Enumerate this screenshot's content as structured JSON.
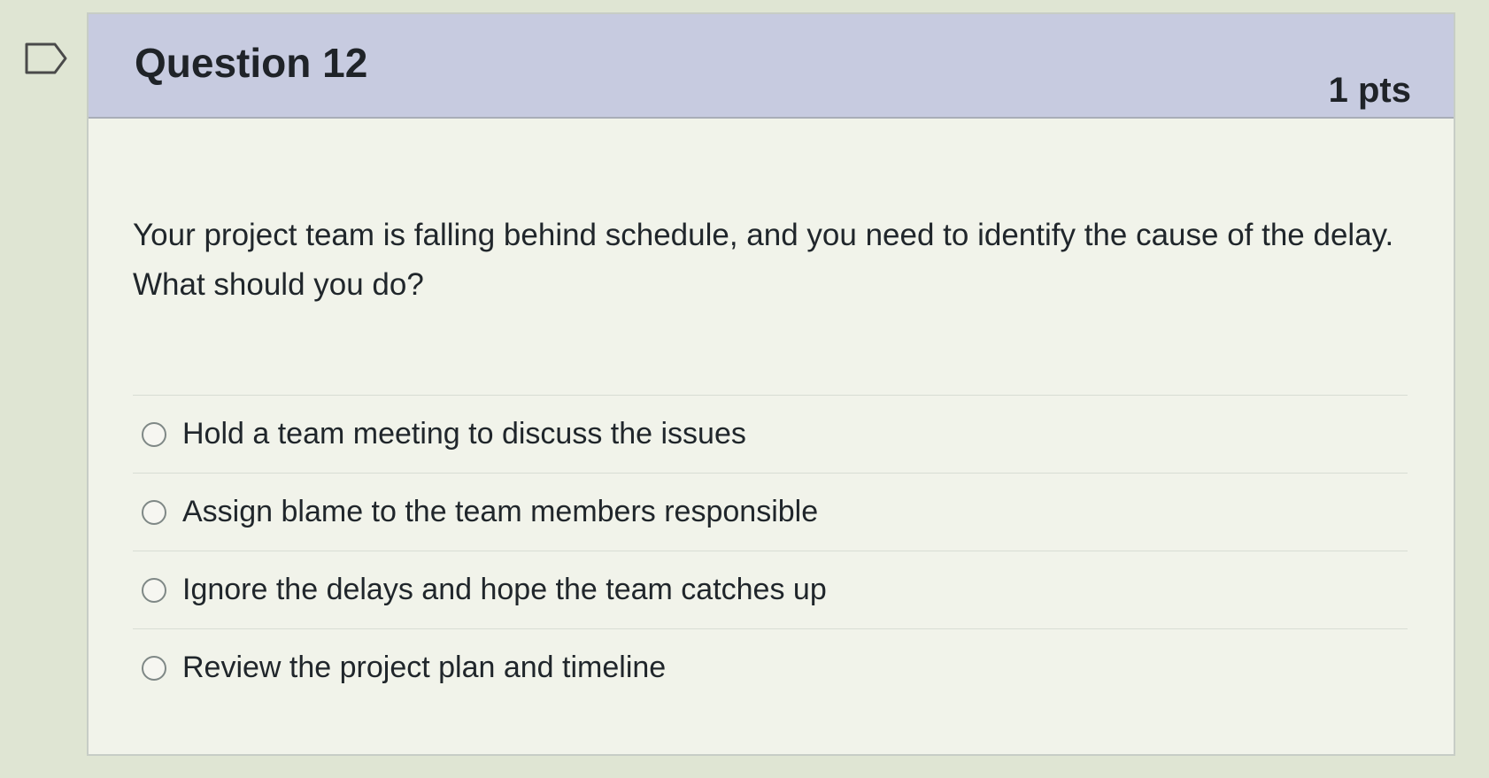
{
  "question": {
    "title": "Question 12",
    "points": "1 pts",
    "text": "Your project team is falling behind schedule, and you need to identify the cause of the delay. What should you do?",
    "answers": [
      {
        "label": "Hold a team meeting to discuss the issues",
        "selected": false
      },
      {
        "label": "Assign blame to the team members responsible",
        "selected": false
      },
      {
        "label": "Ignore the delays and hope the team catches up",
        "selected": false
      },
      {
        "label": "Review the project plan and timeline",
        "selected": false
      }
    ]
  },
  "icons": {
    "flag": "flag-icon",
    "radio": "radio-button-icon"
  },
  "colors": {
    "header_bg": "#c7cbe0",
    "page_bg": "#f1f3ea",
    "outer_bg": "#dfe5d3"
  }
}
